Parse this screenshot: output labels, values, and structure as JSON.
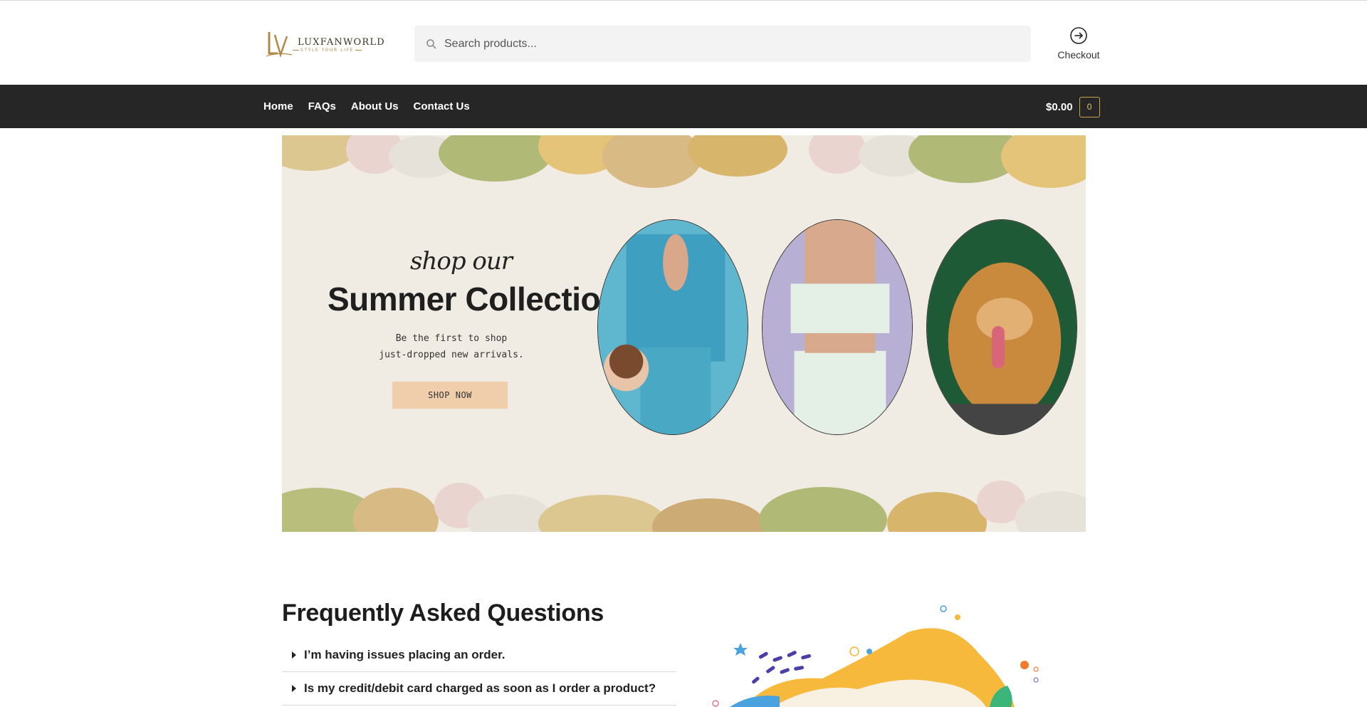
{
  "header": {
    "logo_text": "LUXFANWORLD",
    "logo_tagline": "STYLE YOUR LIFE",
    "search_placeholder": "Search products...",
    "checkout_label": "Checkout"
  },
  "nav": {
    "items": [
      {
        "label": "Home"
      },
      {
        "label": "FAQs"
      },
      {
        "label": "About Us"
      },
      {
        "label": "Contact Us"
      }
    ],
    "cart_total": "$0.00",
    "cart_count": "0"
  },
  "banner": {
    "script": "shop our",
    "title": "Summer Collection",
    "subtitle_line1": "Be the first to shop",
    "subtitle_line2": "just-dropped new arrivals.",
    "button_label": "SHOP NOW"
  },
  "faq": {
    "title": "Frequently Asked Questions",
    "items": [
      {
        "question": "I’m having issues placing an order."
      },
      {
        "question": "Is my credit/debit card charged as soon as I order a product?"
      }
    ]
  },
  "colors": {
    "navbar": "#262626",
    "accent_gold": "#c9a54a",
    "banner_button": "#f0ceab"
  }
}
